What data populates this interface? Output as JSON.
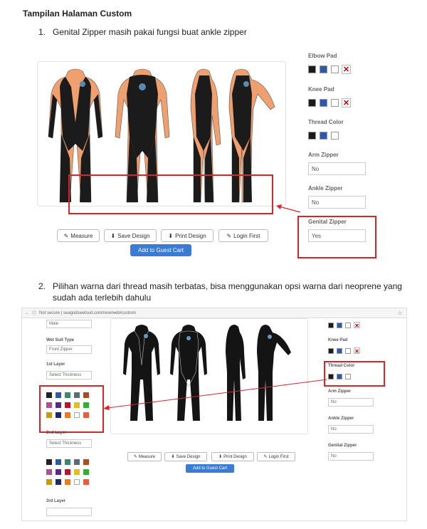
{
  "doc": {
    "title": "Tampilan Halaman Custom",
    "item1": {
      "num": "1.",
      "text": "Genital Zipper masih pakai fungsi buat ankle zipper"
    },
    "item2": {
      "num": "2.",
      "line1": "Pilihan warna dari thread masih terbatas, bisa menggunakan opsi warna dari neoprene yang",
      "line2": "sudah ada terlebih dahulu"
    }
  },
  "screenshot1": {
    "options": {
      "elbow_pad": "Elbow Pad",
      "knee_pad": "Knee Pad",
      "thread_color": "Thread Color",
      "arm_zipper": "Arm Zipper",
      "arm_zipper_value": "No",
      "ankle_zipper": "Ankle Zipper",
      "ankle_zipper_value": "No",
      "genital_zipper": "Genital Zipper",
      "genital_zipper_value": "Yes"
    },
    "buttons": {
      "measure": "Measure",
      "save": "Save Design",
      "print": "Print Design",
      "login": "Login First",
      "add_cart": "Add to Guest Cart"
    },
    "colors": {
      "orange": "#f0a06f",
      "black": "#1b1b1b",
      "blue": "#2e58a8",
      "red": "#d9252a",
      "primary": "#3a7bd5"
    }
  },
  "screenshot2": {
    "address": "Not secure | seagodswetsuit.com/new/web/custom/",
    "left": {
      "gender_value": "Male",
      "wet_suit_type": "Wet Suit Type",
      "wet_suit_value": "Front Zipper",
      "layer1": "1st Layer",
      "layer1_select": "Select Thickness",
      "layer2": "2nd Layer",
      "layer2_select": "Select Thickness",
      "layer3": "3rd Layer"
    },
    "right": {
      "knee_pad": "Knee Pad",
      "thread_color": "Thread Color",
      "arm_zipper": "Arm Zipper",
      "arm_zipper_value": "No",
      "ankle_zipper": "Ankle Zipper",
      "ankle_zipper_value": "No",
      "genital_zipper": "Genital Zipper",
      "genital_zipper_value": "No"
    },
    "buttons": {
      "measure": "Measure",
      "save": "Save Design",
      "print": "Print Design",
      "login": "Login First",
      "add_cart": "Add to Guest Cart"
    },
    "palette": [
      "#222222",
      "#2e58a8",
      "#3a8a6a",
      "#5a6a7a",
      "#b04a20",
      "#b05090",
      "#5a2a8a",
      "#c0102a",
      "#e0c020",
      "#30b030",
      "#c89a10",
      "#1a2a6a",
      "#f07a20",
      "#ffffff",
      "#f05a3a"
    ],
    "palette2": [
      "#222222",
      "#2e58a8",
      "#3a8a6a",
      "#5a6a7a",
      "#b04a20",
      "#b05090",
      "#5a2a8a",
      "#c0102a",
      "#e0c020",
      "#30b030",
      "#c89a10",
      "#1a2a6a",
      "#f07a20",
      "#ffffff",
      "#f05a3a"
    ]
  }
}
